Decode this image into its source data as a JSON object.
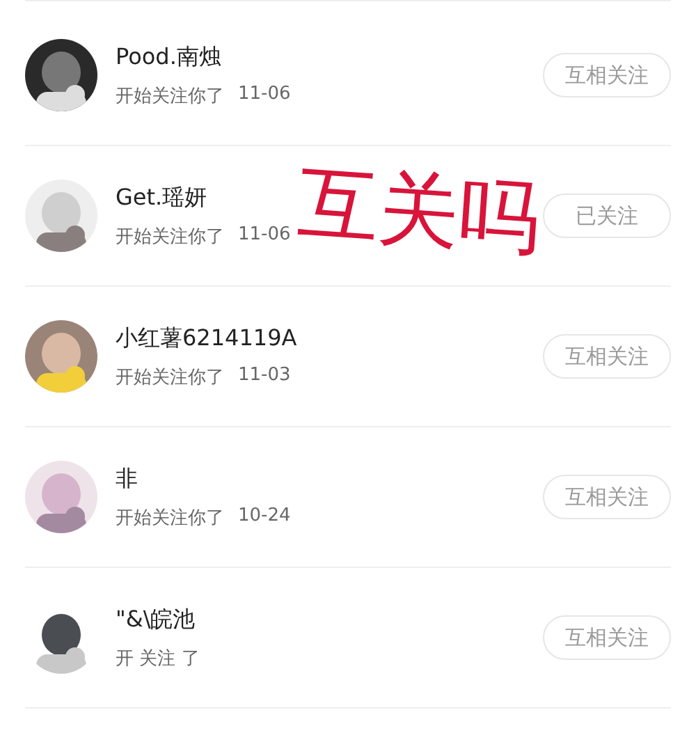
{
  "followers": [
    {
      "name": "Pood.南烛",
      "activity": "开始关注你了",
      "date": "11-06",
      "button": "互相关注"
    },
    {
      "name": "Get.瑶妍",
      "activity": "开始关注你了",
      "date": "11-06",
      "button": "已关注"
    },
    {
      "name": "小红薯6214119A",
      "activity": "开始关注你了",
      "date": "11-03",
      "button": "互相关注"
    },
    {
      "name": "非",
      "activity": "开始关注你了",
      "date": "10-24",
      "button": "互相关注"
    },
    {
      "name": "\"&\\皖池",
      "activity": "开 关注 了",
      "button": "互相关注"
    }
  ],
  "overlay_text": "互关吗"
}
